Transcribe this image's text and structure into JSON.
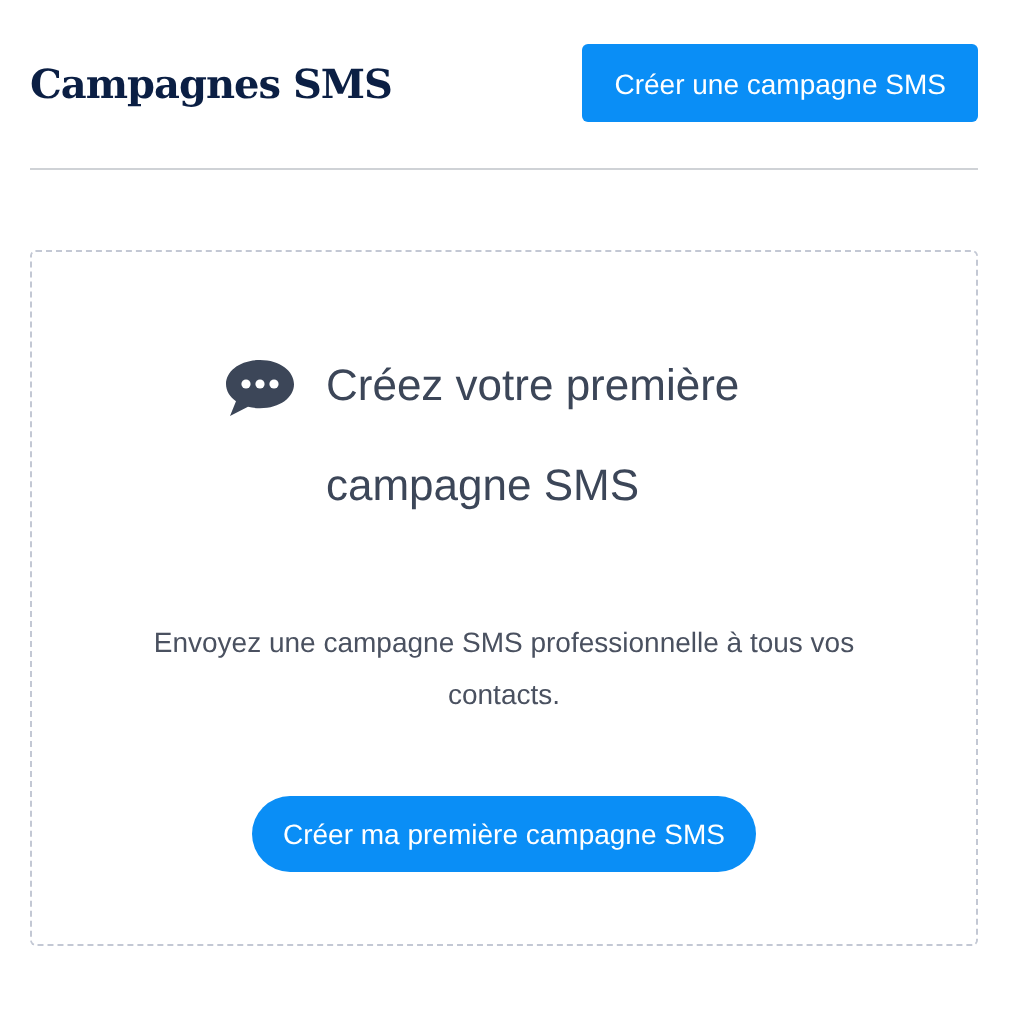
{
  "header": {
    "title": "Campagnes SMS",
    "button": "Créer une campagne SMS"
  },
  "empty_state": {
    "title": "Créez votre première campagne SMS",
    "text": "Envoyez une campagne SMS professionnelle à tous vos contacts.",
    "button": "Créer ma première campagne SMS"
  }
}
